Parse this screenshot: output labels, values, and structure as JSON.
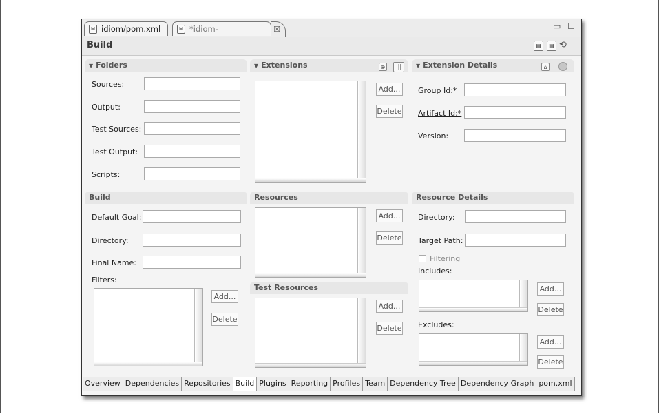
{
  "editor": {
    "tabs": [
      {
        "label": "idiom/pom.xml",
        "icon": "maven-file-icon"
      },
      {
        "label": "*idiom-core/pom.xml",
        "icon": "maven-file-icon"
      }
    ],
    "close_glyph": "☒",
    "window_controls": "▭ ☐",
    "page_title": "Build"
  },
  "folders": {
    "title": "Folders",
    "sources_label": "Sources:",
    "output_label": "Output:",
    "test_sources_label": "Test Sources:",
    "test_output_label": "Test Output:",
    "scripts_label": "Scripts:"
  },
  "extensions": {
    "title": "Extensions",
    "add_label": "Add...",
    "delete_label": "Delete"
  },
  "extension_details": {
    "title": "Extension Details",
    "group_id_label": "Group Id:*",
    "artifact_id_label": "Artifact Id:*",
    "version_label": "Version:"
  },
  "build": {
    "title": "Build",
    "default_goal_label": "Default Goal:",
    "directory_label": "Directory:",
    "final_name_label": "Final Name:",
    "filters_label": "Filters:",
    "add_label": "Add...",
    "delete_label": "Delete"
  },
  "resources": {
    "title": "Resources",
    "add_label": "Add...",
    "delete_label": "Delete"
  },
  "test_resources": {
    "title": "Test Resources",
    "add_label": "Add...",
    "delete_label": "Delete"
  },
  "resource_details": {
    "title": "Resource Details",
    "directory_label": "Directory:",
    "target_path_label": "Target Path:",
    "filtering_label": "Filtering",
    "includes_label": "Includes:",
    "excludes_label": "Excludes:",
    "add_label": "Add...",
    "delete_label": "Delete"
  },
  "bottom_tabs": [
    "Overview",
    "Dependencies",
    "Repositories",
    "Build",
    "Plugins",
    "Reporting",
    "Profiles",
    "Team",
    "Dependency Tree",
    "Dependency Graph",
    "pom.xml"
  ],
  "active_bottom_tab": "Build"
}
